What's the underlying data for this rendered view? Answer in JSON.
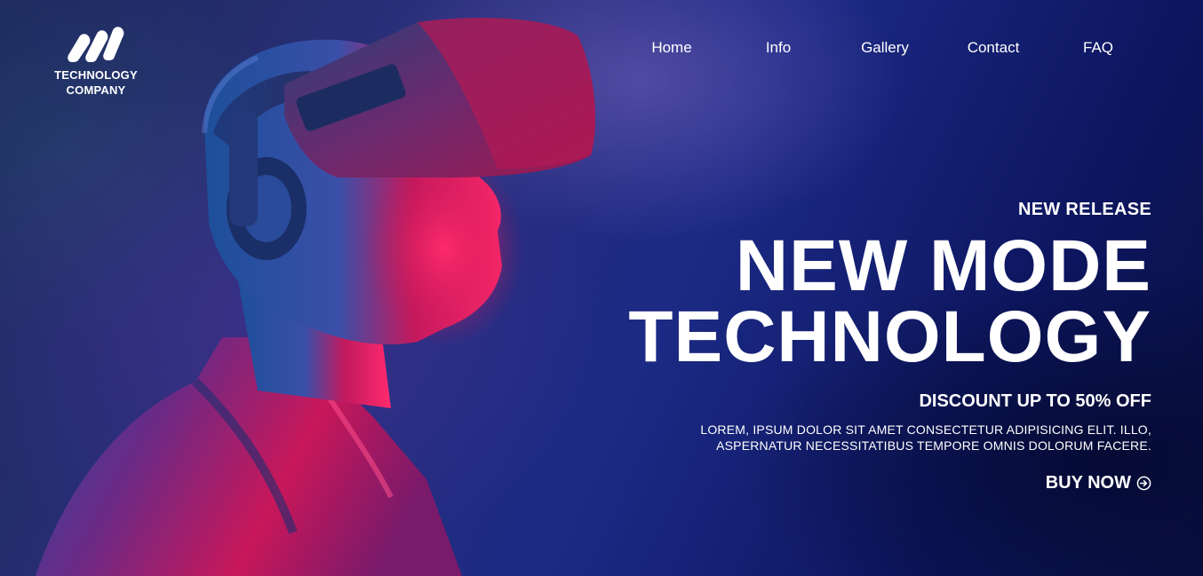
{
  "logo": {
    "text_line1": "TECHNOLOGY",
    "text_line2": "COMPANY",
    "icon": "wave-stripes-logo-icon"
  },
  "nav": {
    "items": [
      {
        "label": "Home"
      },
      {
        "label": "Info"
      },
      {
        "label": "Gallery"
      },
      {
        "label": "Contact"
      },
      {
        "label": "FAQ"
      }
    ]
  },
  "hero": {
    "eyebrow": "NEW RELEASE",
    "headline_line1": "NEW MODE",
    "headline_line2": "TECHNOLOGY",
    "discount": "DISCOUNT UP TO 50% OFF",
    "description_line1": "LOREM, IPSUM DOLOR SIT AMET CONSECTETUR ADIPISICING ELIT. ILLO,",
    "description_line2": "ASPERNATUR NECESSITATIBUS TEMPORE OMNIS DOLORUM FACERE.",
    "cta_label": "BUY NOW",
    "cta_icon": "arrow-circle-right-icon",
    "image": "person-wearing-vr-headset-photo"
  },
  "colors": {
    "background_dark": "#0a1042",
    "background_mid": "#2a2f7a",
    "accent_pink": "#e8195f",
    "accent_blue": "#1a73d9",
    "text": "#ffffff"
  }
}
